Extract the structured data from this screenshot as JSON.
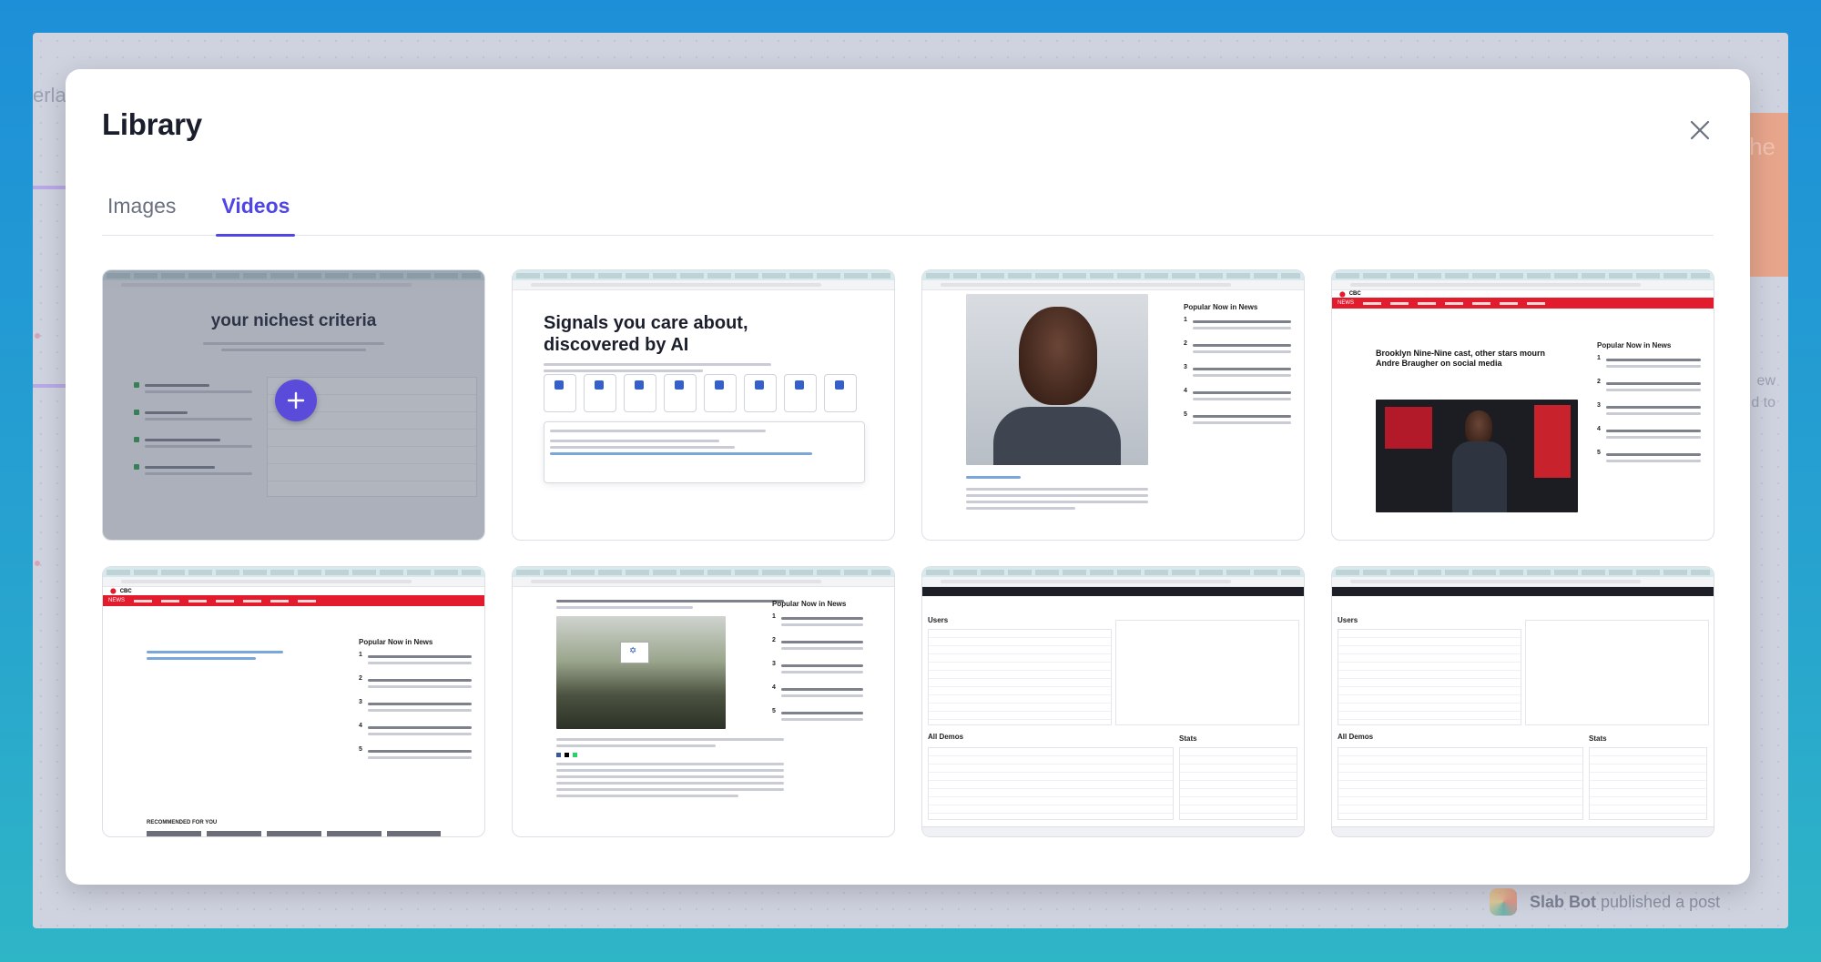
{
  "background_app": {
    "fragment_left": "erla",
    "fragment_right_top": "he",
    "fragment_right_mid1": "ew",
    "fragment_right_mid2": "d to",
    "slab_name": "Slab Bot",
    "slab_action": "published a post"
  },
  "modal": {
    "title": "Library",
    "tabs": [
      {
        "label": "Images",
        "active": false
      },
      {
        "label": "Videos",
        "active": true
      }
    ]
  },
  "thumbnails": [
    {
      "headline": "your nichest criteria",
      "has_add_button": true
    },
    {
      "headline": "Signals you care about, discovered by AI"
    },
    {
      "rail_title": "Popular Now in News"
    },
    {
      "headline": "Brooklyn Nine-Nine cast, other stars mourn Andre Braugher on social media",
      "rail_title": "Popular Now in News",
      "brand": "CBC",
      "section": "NEWS"
    },
    {
      "rail_title": "Popular Now in News",
      "footer": "RECOMMENDED FOR YOU",
      "brand": "CBC",
      "section": "NEWS"
    },
    {
      "rail_title": "Popular Now in News"
    },
    {
      "section1": "Users",
      "section2": "All Demos",
      "section3": "Stats"
    },
    {
      "section1": "Users",
      "section2": "All Demos",
      "section3": "Stats"
    }
  ],
  "colors": {
    "accent": "#4f46e5",
    "plus_button": "#5b4bdb",
    "news_red": "#e21b2d"
  }
}
